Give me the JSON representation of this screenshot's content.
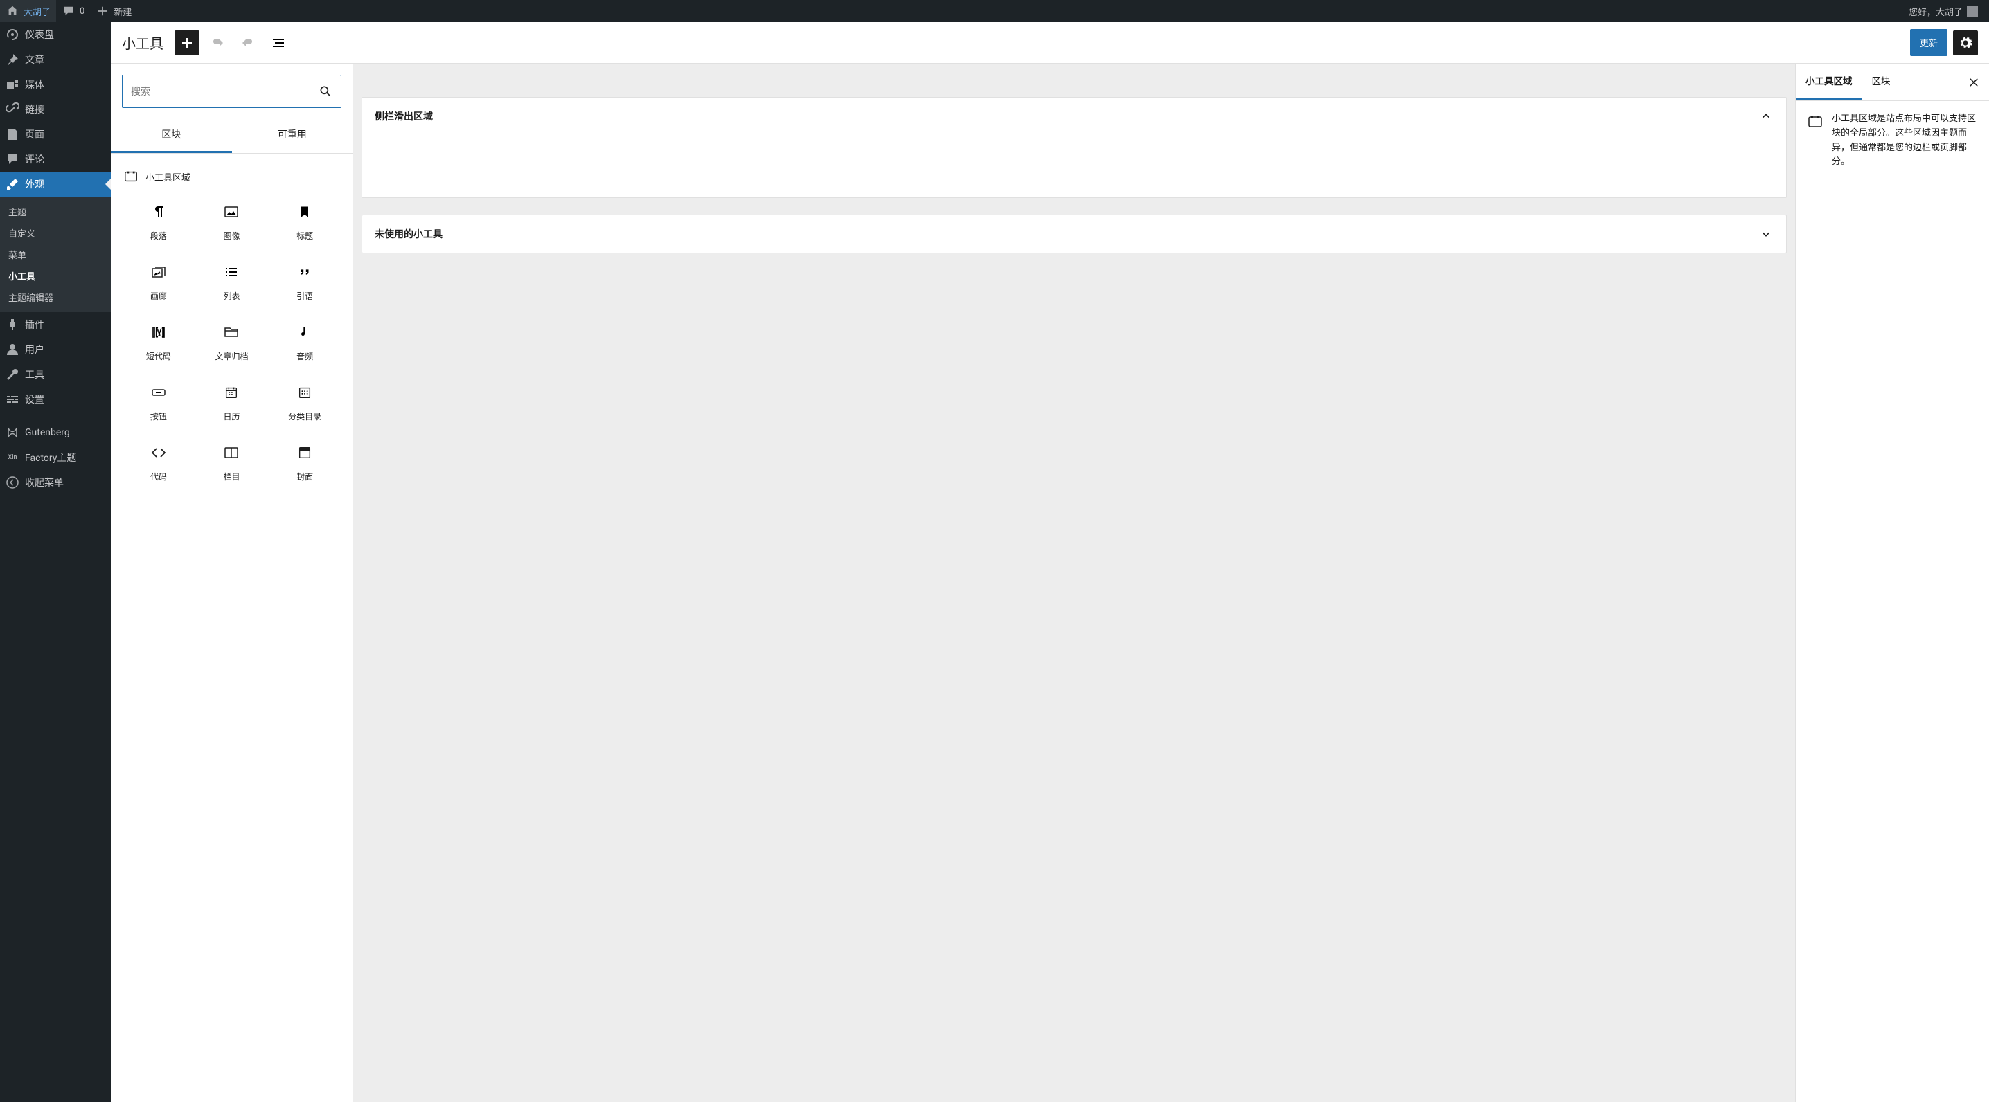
{
  "adminbar": {
    "site_name": "大胡子",
    "comments_count": "0",
    "new_label": "新建",
    "greeting": "您好，大胡子"
  },
  "sidemenu": {
    "dashboard": "仪表盘",
    "posts": "文章",
    "media": "媒体",
    "links": "链接",
    "pages": "页面",
    "comments": "评论",
    "appearance": "外观",
    "appearance_sub": {
      "themes": "主题",
      "customize": "自定义",
      "menus": "菜单",
      "widgets": "小工具",
      "theme_editor": "主题编辑器"
    },
    "plugins": "插件",
    "users": "用户",
    "tools": "工具",
    "settings": "设置",
    "gutenberg": "Gutenberg",
    "factory": "Factory主题",
    "collapse": "收起菜单"
  },
  "header": {
    "title": "小工具",
    "update_button": "更新"
  },
  "inserter": {
    "search_placeholder": "搜索",
    "tab_blocks": "区块",
    "tab_reusable": "可重用",
    "category_widget_area": "小工具区域",
    "blocks": {
      "paragraph": "段落",
      "image": "图像",
      "heading": "标题",
      "gallery": "画廊",
      "list": "列表",
      "quote": "引语",
      "shortcode": "短代码",
      "archives": "文章归档",
      "audio": "音频",
      "button": "按钮",
      "calendar": "日历",
      "categories": "分类目录",
      "code": "代码",
      "columns": "栏目",
      "cover": "封面"
    }
  },
  "canvas": {
    "area1_title": "侧栏滑出区域",
    "area2_title": "未使用的小工具"
  },
  "settings": {
    "tab_widget_area": "小工具区域",
    "tab_block": "区块",
    "description": "小工具区域是站点布局中可以支持区块的全局部分。这些区域因主题而异，但通常都是您的边栏或页脚部分。"
  }
}
